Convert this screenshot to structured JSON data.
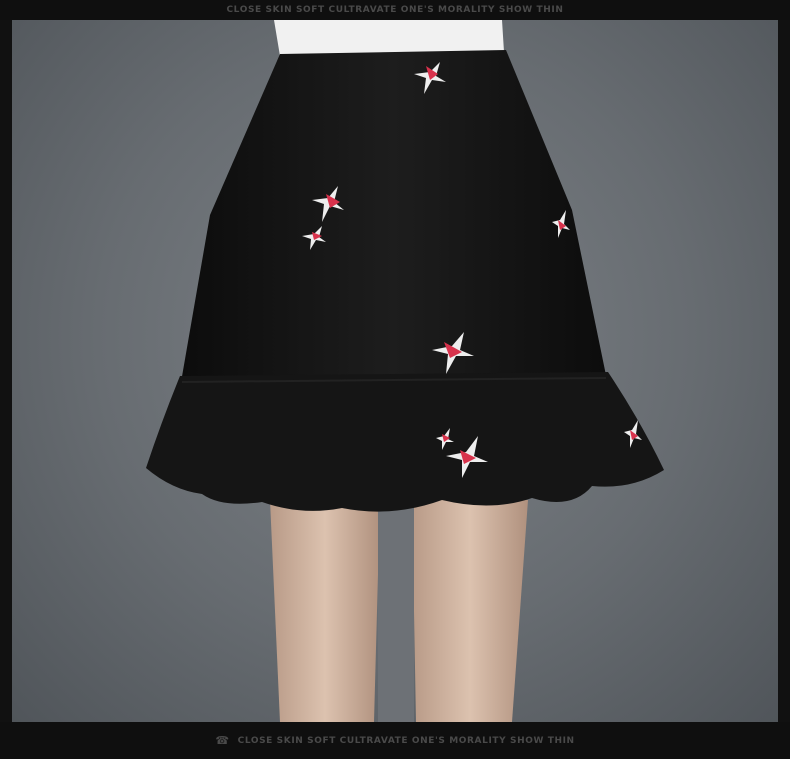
{
  "banner": {
    "top_text": "CLOSE SKIN SOFT CULTRAVATE ONE'S MORALITY SHOW THIN",
    "bottom_text": "CLOSE SKIN SOFT CULTRAVATE ONE'S MORALITY SHOW THIN",
    "bottom_icon": "telephone-icon"
  },
  "colors": {
    "background": "#111111",
    "skirt": "#121212",
    "embroidery_red": "#d8324c",
    "embroidery_white": "#eeeeee"
  }
}
